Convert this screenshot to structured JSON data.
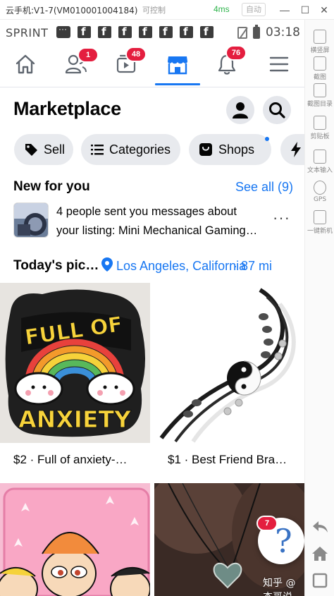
{
  "emulator": {
    "title": "云手机:V1-7(VM010001004184)",
    "control_label": "可控制",
    "latency": "4ms",
    "auto_label": "自动",
    "side_tools": [
      "横竖屏",
      "截图",
      "截图目录",
      "剪贴板",
      "文本输入",
      "GPS",
      "一键新机"
    ],
    "watermark": "知乎 @杰哥说"
  },
  "status_bar": {
    "carrier": "SPRINT",
    "time": "03:18"
  },
  "tabbar": {
    "tabs": [
      {
        "name": "home",
        "badge": ""
      },
      {
        "name": "friends",
        "badge": "1"
      },
      {
        "name": "watch",
        "badge": "48"
      },
      {
        "name": "marketplace",
        "badge": ""
      },
      {
        "name": "notifications",
        "badge": "76"
      },
      {
        "name": "menu",
        "badge": ""
      }
    ],
    "active_color": "#1877f2"
  },
  "header": {
    "title": "Marketplace"
  },
  "chips": [
    {
      "label": "Sell",
      "icon": "tag-icon"
    },
    {
      "label": "Categories",
      "icon": "list-icon"
    },
    {
      "label": "Shops",
      "icon": "shop-icon"
    },
    {
      "label": "",
      "icon": "lightning-icon"
    }
  ],
  "new_for_you": {
    "title": "New for you",
    "see_all": "See all (9)",
    "notification_line1": "4 people sent you messages about",
    "notification_line2": "your listing: Mini Mechanical Gaming…",
    "more": "···"
  },
  "todays_picks": {
    "title": "Today's pic…",
    "location": "Los Angeles, California",
    "distance": "· 87 mi"
  },
  "listings": [
    {
      "label": "$2 · Full of anxiety-…",
      "image_text_line1": "FULL OF",
      "image_text_line2": "ANXIETY"
    },
    {
      "label": "$1 · Best Friend Bra…"
    },
    {
      "label": ""
    },
    {
      "label": ""
    }
  ],
  "help": {
    "badge": "7",
    "symbol": "?"
  },
  "colors": {
    "fb_blue": "#1877f2",
    "badge_red": "#e41e3f",
    "chip_bg": "#e8eaee"
  }
}
